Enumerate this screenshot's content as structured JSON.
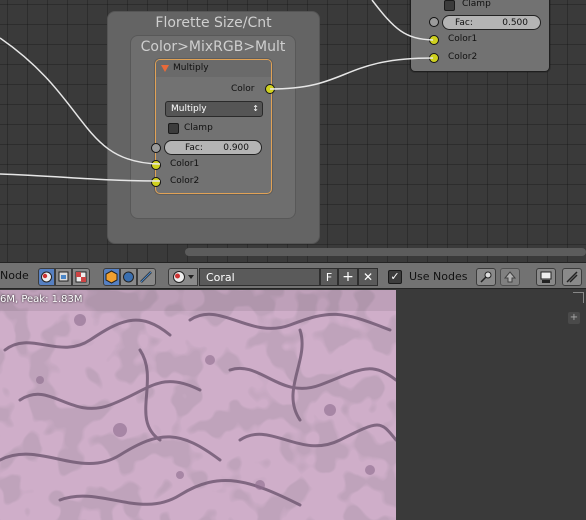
{
  "node_editor": {
    "frame_title": "Florette Size/Cnt",
    "group_title": "Color>MixRGB>Mult",
    "mix_node": {
      "title": "Multiply",
      "output_label": "Color",
      "blend_mode": "Multiply",
      "clamp_label": "Clamp",
      "fac_label": "Fac:",
      "fac_value": "0.900",
      "input1_label": "Color1",
      "input2_label": "Color2"
    },
    "top_right_node": {
      "clamp_label": "Clamp",
      "fac_label": "Fac:",
      "fac_value": "0.500",
      "input1_label": "Color1",
      "input2_label": "Color2"
    }
  },
  "header": {
    "editor_label": "Node",
    "material_name": "Coral",
    "fake_user_label": "F",
    "use_nodes_label": "Use Nodes"
  },
  "viewer": {
    "memory_text": "6M, Peak: 1.83M"
  },
  "colors": {
    "socket_yellow": "#cfd11f",
    "active_node_border": "#e1a256",
    "toggle_blue": "#5680c2",
    "render_pink": "#cfaec9"
  }
}
